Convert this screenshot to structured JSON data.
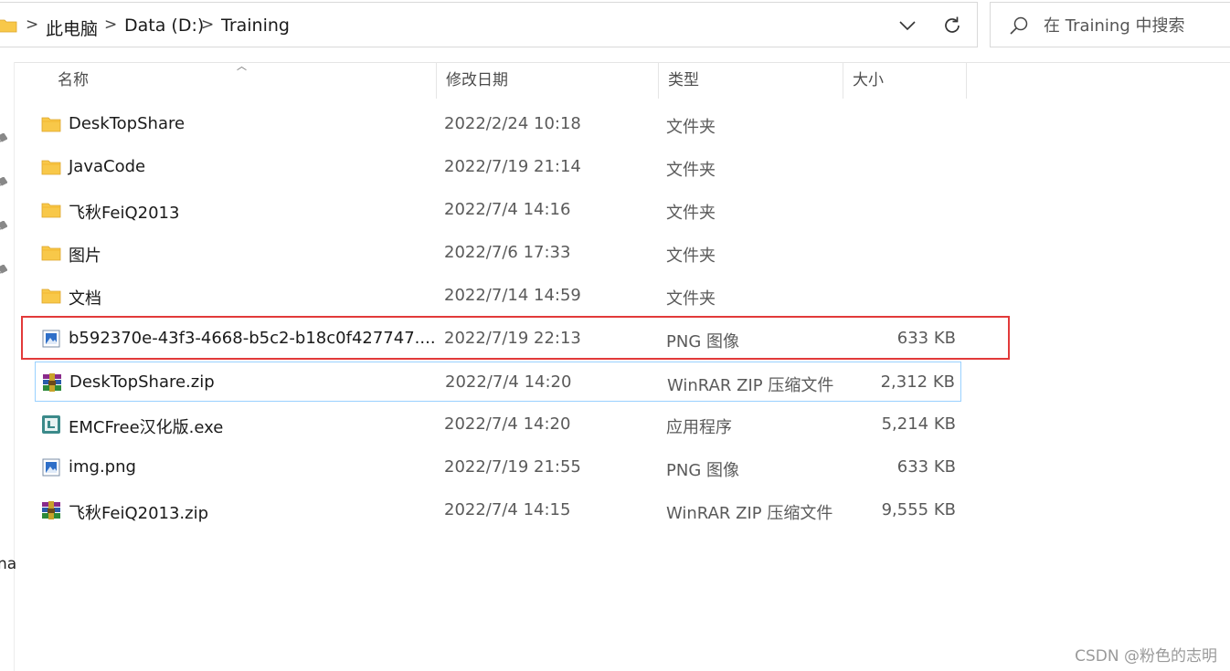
{
  "address_bar": {
    "breadcrumbs": [
      "此电脑",
      "Data (D:)",
      "Training"
    ],
    "separator": ">"
  },
  "search": {
    "placeholder": "在 Training 中搜索"
  },
  "nav_pane": {
    "fragment_text": "na"
  },
  "columns": {
    "name": "名称",
    "date": "修改日期",
    "type": "类型",
    "size": "大小"
  },
  "files": [
    {
      "name": "DeskTopShare",
      "date": "2022/2/24 10:18",
      "type": "文件夹",
      "size": "",
      "icon": "folder-icon"
    },
    {
      "name": "JavaCode",
      "date": "2022/7/19 21:14",
      "type": "文件夹",
      "size": "",
      "icon": "folder-icon"
    },
    {
      "name": "飞秋FeiQ2013",
      "date": "2022/7/4 14:16",
      "type": "文件夹",
      "size": "",
      "icon": "folder-icon"
    },
    {
      "name": "图片",
      "date": "2022/7/6 17:33",
      "type": "文件夹",
      "size": "",
      "icon": "folder-icon"
    },
    {
      "name": "文档",
      "date": "2022/7/14 14:59",
      "type": "文件夹",
      "size": "",
      "icon": "folder-icon"
    },
    {
      "name": "b592370e-43f3-4668-b5c2-b18c0f427747....",
      "date": "2022/7/19 22:13",
      "type": "PNG 图像",
      "size": "633 KB",
      "icon": "png-image-icon"
    },
    {
      "name": "DeskTopShare.zip",
      "date": "2022/7/4 14:20",
      "type": "WinRAR ZIP 压缩文件",
      "size": "2,312 KB",
      "icon": "winrar-archive-icon"
    },
    {
      "name": "EMCFree汉化版.exe",
      "date": "2022/7/4 14:20",
      "type": "应用程序",
      "size": "5,214 KB",
      "icon": "exe-app-icon"
    },
    {
      "name": "img.png",
      "date": "2022/7/19 21:55",
      "type": "PNG 图像",
      "size": "633 KB",
      "icon": "png-image-icon"
    },
    {
      "name": "飞秋FeiQ2013.zip",
      "date": "2022/7/4 14:15",
      "type": "WinRAR ZIP 压缩文件",
      "size": "9,555 KB",
      "icon": "winrar-archive-icon"
    }
  ],
  "hover_row_index": 6,
  "highlighted_row_index": 5,
  "colors": {
    "highlight_border": "#e23a3a",
    "hover_border": "#99d1ff",
    "folder_yellow": "#f8c849"
  },
  "watermark": "CSDN @粉色的志明"
}
